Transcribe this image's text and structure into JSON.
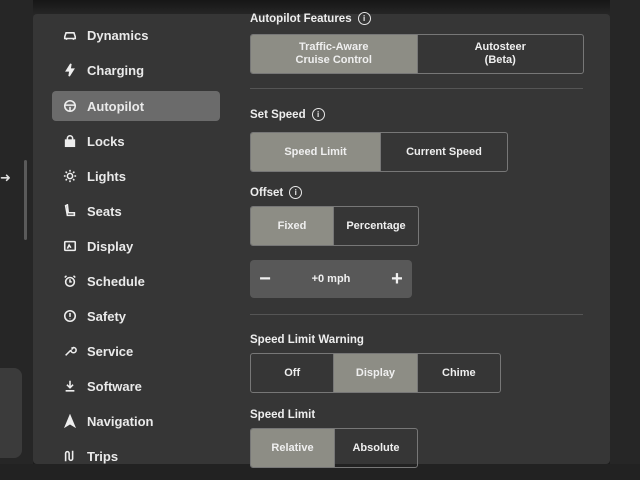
{
  "sidebar": {
    "items": [
      {
        "label": "Dynamics",
        "icon": "car-icon",
        "active": false
      },
      {
        "label": "Charging",
        "icon": "bolt-icon",
        "active": false
      },
      {
        "label": "Autopilot",
        "icon": "steering-wheel-icon",
        "active": true
      },
      {
        "label": "Locks",
        "icon": "lock-icon",
        "active": false
      },
      {
        "label": "Lights",
        "icon": "sun-icon",
        "active": false
      },
      {
        "label": "Seats",
        "icon": "seat-icon",
        "active": false
      },
      {
        "label": "Display",
        "icon": "display-icon",
        "active": false
      },
      {
        "label": "Schedule",
        "icon": "alarm-clock-icon",
        "active": false
      },
      {
        "label": "Safety",
        "icon": "warning-icon",
        "active": false
      },
      {
        "label": "Service",
        "icon": "wrench-icon",
        "active": false
      },
      {
        "label": "Software",
        "icon": "download-icon",
        "active": false
      },
      {
        "label": "Navigation",
        "icon": "navigation-arrow-icon",
        "active": false
      },
      {
        "label": "Trips",
        "icon": "trips-icon",
        "active": false
      }
    ]
  },
  "main": {
    "autopilot_features": {
      "title": "Autopilot Features",
      "options": [
        {
          "line1": "Traffic-Aware",
          "line2": "Cruise Control",
          "selected": true
        },
        {
          "line1": "Autosteer",
          "line2": "(Beta)",
          "selected": false
        }
      ]
    },
    "set_speed": {
      "title": "Set Speed",
      "options": [
        {
          "label": "Speed Limit",
          "selected": true
        },
        {
          "label": "Current Speed",
          "selected": false
        }
      ]
    },
    "offset": {
      "title": "Offset",
      "options": [
        {
          "label": "Fixed",
          "selected": true
        },
        {
          "label": "Percentage",
          "selected": false
        }
      ],
      "stepper": {
        "minus": "−",
        "value": "+0 mph",
        "plus": "+"
      }
    },
    "speed_limit_warning": {
      "title": "Speed Limit Warning",
      "options": [
        {
          "label": "Off",
          "selected": false
        },
        {
          "label": "Display",
          "selected": true
        },
        {
          "label": "Chime",
          "selected": false
        }
      ]
    },
    "speed_limit": {
      "title": "Speed Limit",
      "options": [
        {
          "label": "Relative",
          "selected": true
        },
        {
          "label": "Absolute",
          "selected": false
        }
      ]
    }
  },
  "colors": {
    "background": "#363636",
    "selected_option": "#8d8d85",
    "active_nav": "#6b6b6b"
  }
}
